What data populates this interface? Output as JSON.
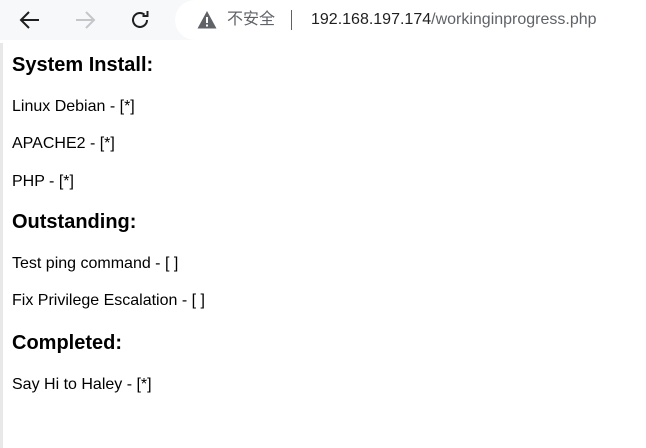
{
  "browser": {
    "security_text": "不安全",
    "url_host": "192.168.197.174",
    "url_path": "/workinginprogress.php"
  },
  "content": {
    "system_install_heading": "System Install:",
    "system_install_items": [
      "Linux Debian - [*]",
      "APACHE2 - [*]",
      "PHP - [*]"
    ],
    "outstanding_heading": "Outstanding:",
    "outstanding_items": [
      "Test ping command - [ ]",
      "Fix Privilege Escalation - [ ]"
    ],
    "completed_heading": "Completed:",
    "completed_items": [
      "Say Hi to Haley - [*]"
    ]
  }
}
